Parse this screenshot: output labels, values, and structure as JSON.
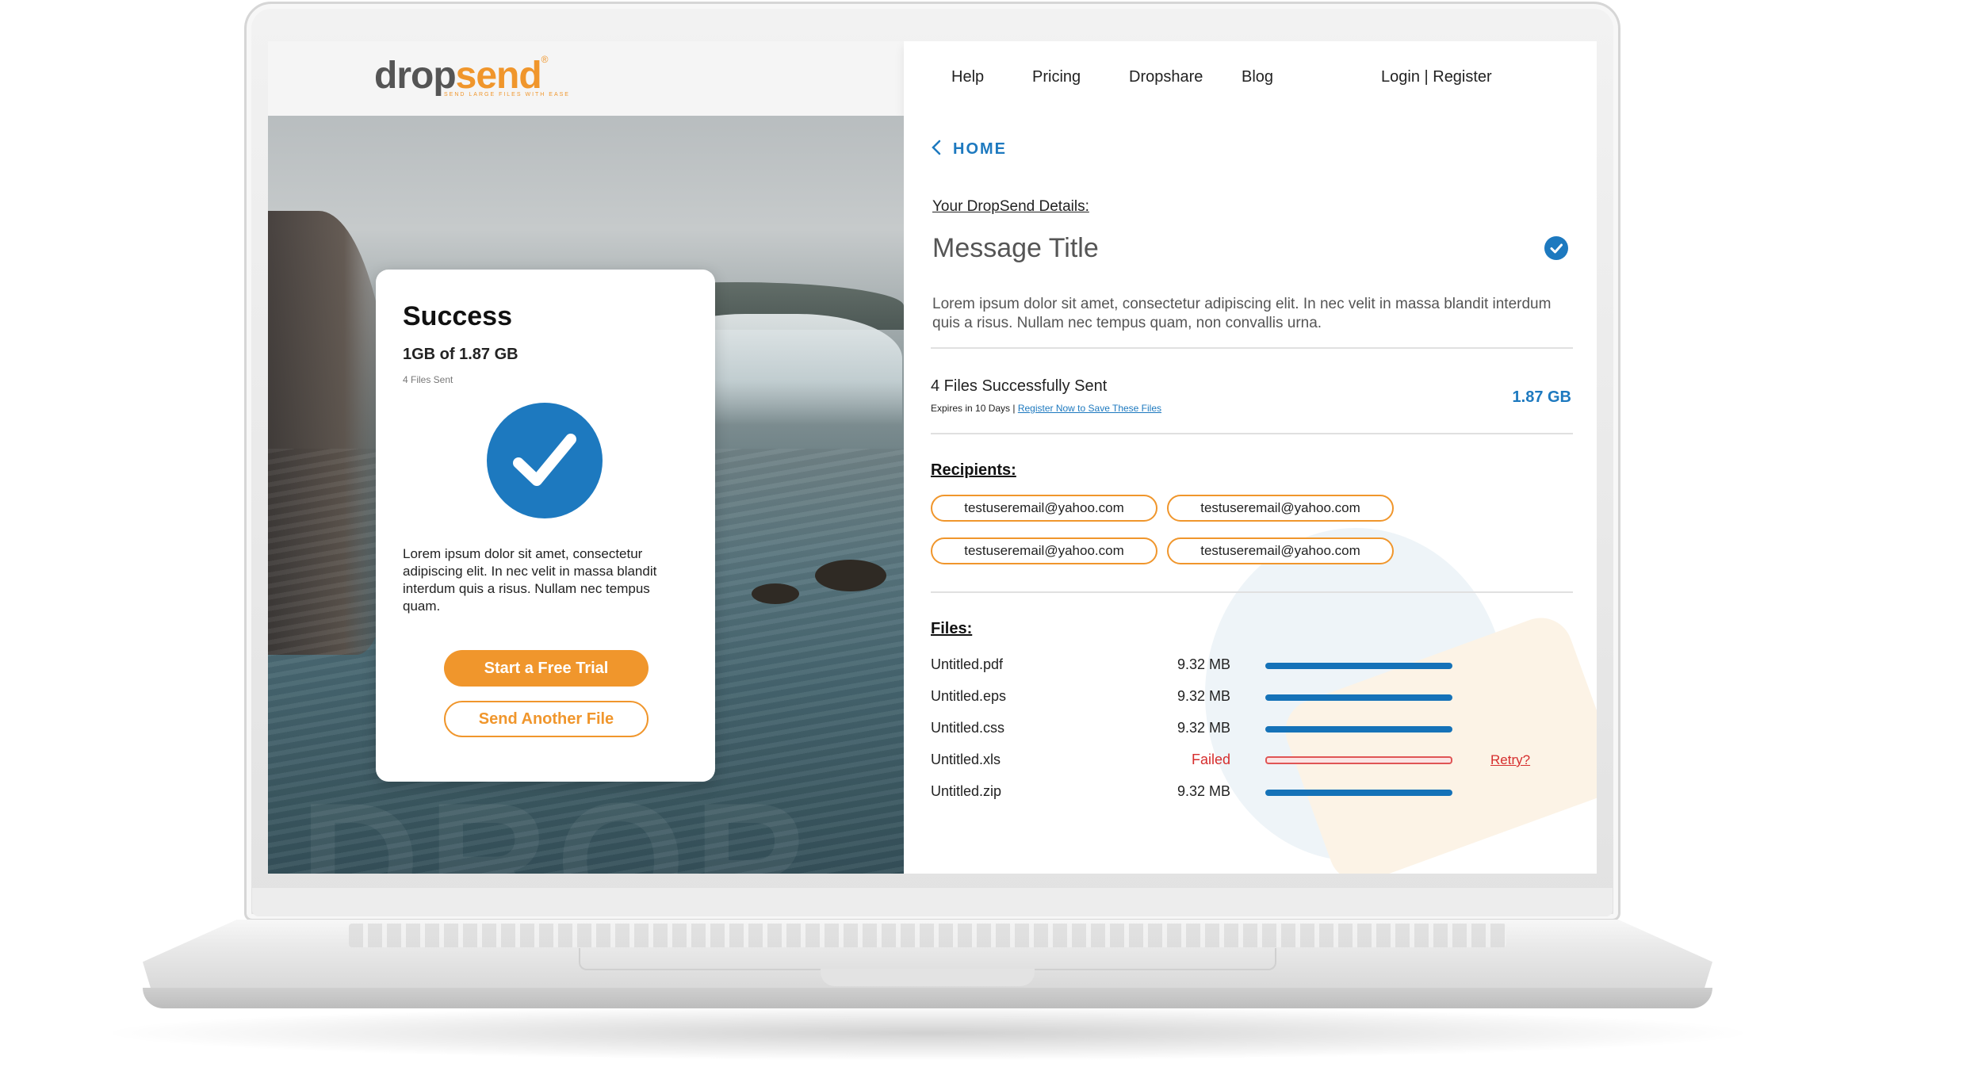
{
  "brand": {
    "name_part1": "drop",
    "name_part2": "send",
    "registered": "®",
    "tagline": "SEND LARGE FILES WITH EASE",
    "accent_color": "#f0962c",
    "primary_color": "#1d79bf"
  },
  "nav": {
    "items": [
      "Help",
      "Pricing",
      "Dropshare",
      "Blog"
    ],
    "auth": "Login | Register"
  },
  "hero": {
    "watermark": "DROP"
  },
  "success_card": {
    "title": "Success",
    "size_text": "1GB of 1.87 GB",
    "files_sent": "4 Files Sent",
    "body": "Lorem ipsum dolor sit amet, consectetur adipiscing elit. In nec velit in massa blandit interdum quis a risus. Nullam nec tempus quam.",
    "primary_button": "Start a Free Trial",
    "secondary_button": "Send Another File",
    "icon": "check-circle-icon"
  },
  "details": {
    "back_label": "HOME",
    "section_label": "Your DropSend Details:",
    "message_title": "Message Title",
    "message_body": "Lorem ipsum dolor sit amet, consectetur adipiscing elit. In nec velit in massa blandit interdum quis a risus. Nullam nec tempus quam, non convallis urna.",
    "sent_label": "4 Files Successfully Sent",
    "expires_text": "Expires in 10 Days | ",
    "register_link": "Register Now to Save These Files",
    "total_size": "1.87 GB"
  },
  "recipients": {
    "label": "Recipients:",
    "emails": [
      "testuseremail@yahoo.com",
      "testuseremail@yahoo.com",
      "testuseremail@yahoo.com",
      "testuseremail@yahoo.com"
    ]
  },
  "files": {
    "label": "Files:",
    "items": [
      {
        "name": "Untitled.pdf",
        "size": "9.32 MB",
        "status": "complete",
        "progress": 1.0
      },
      {
        "name": "Untitled.eps",
        "size": "9.32 MB",
        "status": "complete",
        "progress": 1.0
      },
      {
        "name": "Untitled.css",
        "size": "9.32 MB",
        "status": "complete",
        "progress": 1.0
      },
      {
        "name": "Untitled.xls",
        "size": "Failed",
        "status": "failed",
        "progress": 1.0,
        "action": "Retry?"
      },
      {
        "name": "Untitled.zip",
        "size": "9.32 MB",
        "status": "complete",
        "progress": 1.0
      }
    ]
  }
}
